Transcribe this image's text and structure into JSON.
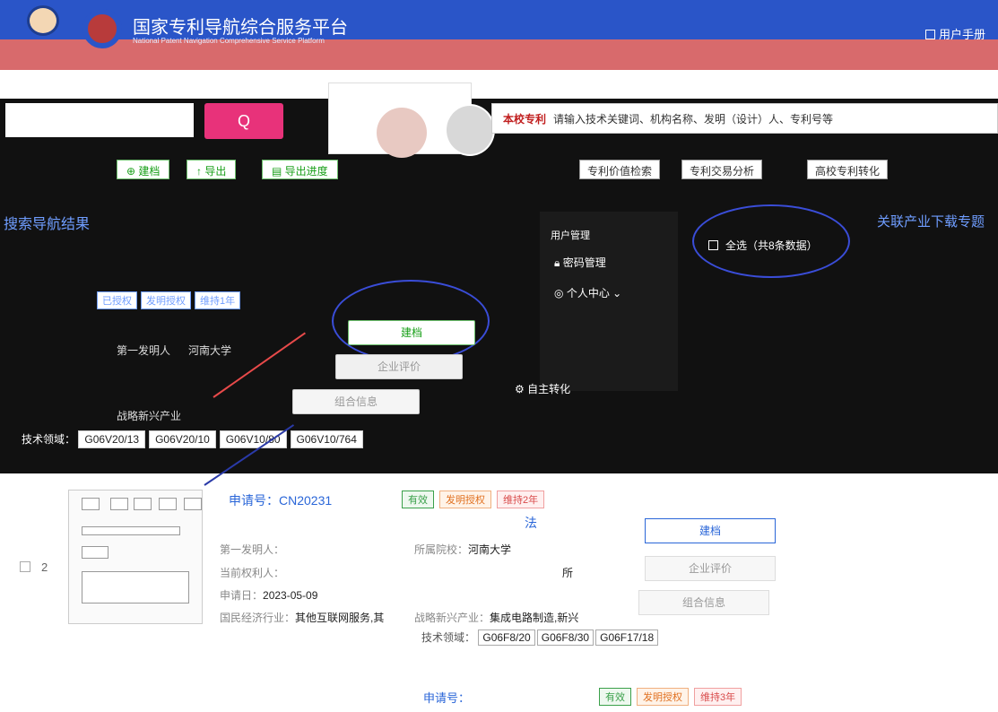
{
  "header": {
    "title": "国家专利导航综合服务平台",
    "subtitle": "National Patent Navigation Comprehensive Service Platform",
    "manual": "用户手册"
  },
  "search": {
    "search_button": "Q",
    "scope_tag": "本校专利",
    "placeholder": "请输入技术关键词、机构名称、发明（设计）人、专利号等"
  },
  "toolbar": {
    "create": "建档",
    "export": "导出",
    "export_progress": "导出进度",
    "btn_a": "专利价值检索",
    "btn_b": "专利交易分析",
    "btn_c": "高校专利转化"
  },
  "left_heading": "搜索导航结果",
  "right_heading": "关联产业下载专题",
  "dropdown": {
    "title": "用户管理",
    "item1": "密码管理",
    "item2": "个人中心",
    "extra": "自主转化"
  },
  "select_all": "全选（共8条数据）",
  "record1": {
    "tags": [
      "已授权",
      "发明授权",
      "维持1年"
    ],
    "first_inventor_label": "第一发明人",
    "school": "河南大学",
    "industry_label": "战略新兴产业",
    "tech_label": "技术领域：",
    "ipc": [
      "G06V20/13",
      "G06V20/10",
      "G06V10/80",
      "G06V10/764"
    ],
    "create": "建档",
    "evaluate": "企业评价",
    "combo": "组合信息"
  },
  "record2": {
    "index": "2",
    "app_label": "申请号：",
    "app_no": "CN20231",
    "status": [
      "有效",
      "发明授权",
      "维持2年"
    ],
    "title_suffix": "法",
    "first_inventor_label": "第一发明人：",
    "school_label": "所属院校：",
    "school": "河南大学",
    "holder_label": "当前权利人：",
    "holder_suffix": "所",
    "app_date_label": "申请日：",
    "app_date": "2023-05-09",
    "industry_label": "国民经济行业：",
    "industry": "其他互联网服务,其",
    "strategic_label": "战略新兴产业：",
    "strategic": "集成电路制造,新兴",
    "tech_label": "技术领域：",
    "ipc": [
      "G06F8/20",
      "G06F8/30",
      "G06F17/18"
    ],
    "create": "建档",
    "evaluate": "企业评价",
    "combo": "组合信息"
  },
  "record3": {
    "app_label": "申请号：",
    "status": [
      "有效",
      "发明授权",
      "维持3年"
    ]
  },
  "colors": {
    "header_blue": "#2a55c8",
    "header_red": "#d86a6c",
    "link_blue": "#2a66d8",
    "accent_pink": "#e8327a",
    "green": "#1aa01a"
  }
}
